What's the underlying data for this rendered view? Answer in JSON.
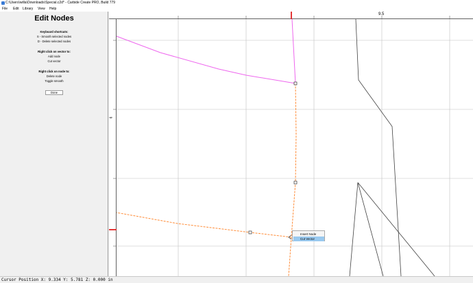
{
  "window": {
    "title": "C:\\Users\\willa\\Downloads\\Special.c2d* - Carbide Create PRO, Build 779"
  },
  "menu": [
    "File",
    "Edit",
    "Library",
    "View",
    "Help"
  ],
  "panel": {
    "title": "Edit Nodes",
    "keyboard_heading": "Keyboard shortcuts:",
    "keyboard_lines": [
      "S - Smooth selected nodes",
      "D - Delete selected nodes"
    ],
    "vector_heading": "Right click on vector to:",
    "vector_lines": [
      "Add node",
      "Cut vector"
    ],
    "node_heading": "Right click on node to:",
    "node_lines": [
      "Delete node",
      "Toggle smooth"
    ],
    "done_label": "Done"
  },
  "rulers": {
    "x_label": "9.5",
    "y_label": "6"
  },
  "context_menu": {
    "items": [
      "Insert Node",
      "Cut Vector"
    ],
    "selected": "Cut Vector"
  },
  "status": {
    "cursor_position": "Cursor Position X: 9.334 Y: 5.781 Z: 0.000 in"
  },
  "colors": {
    "selected_vector": "#ff8c38",
    "magenta_vector": "#ee66ee",
    "other_vector": "#404040",
    "grid": "#c0c0c0",
    "ruler_marker": "#e0201f",
    "menu_highlight": "#99c9ef"
  }
}
